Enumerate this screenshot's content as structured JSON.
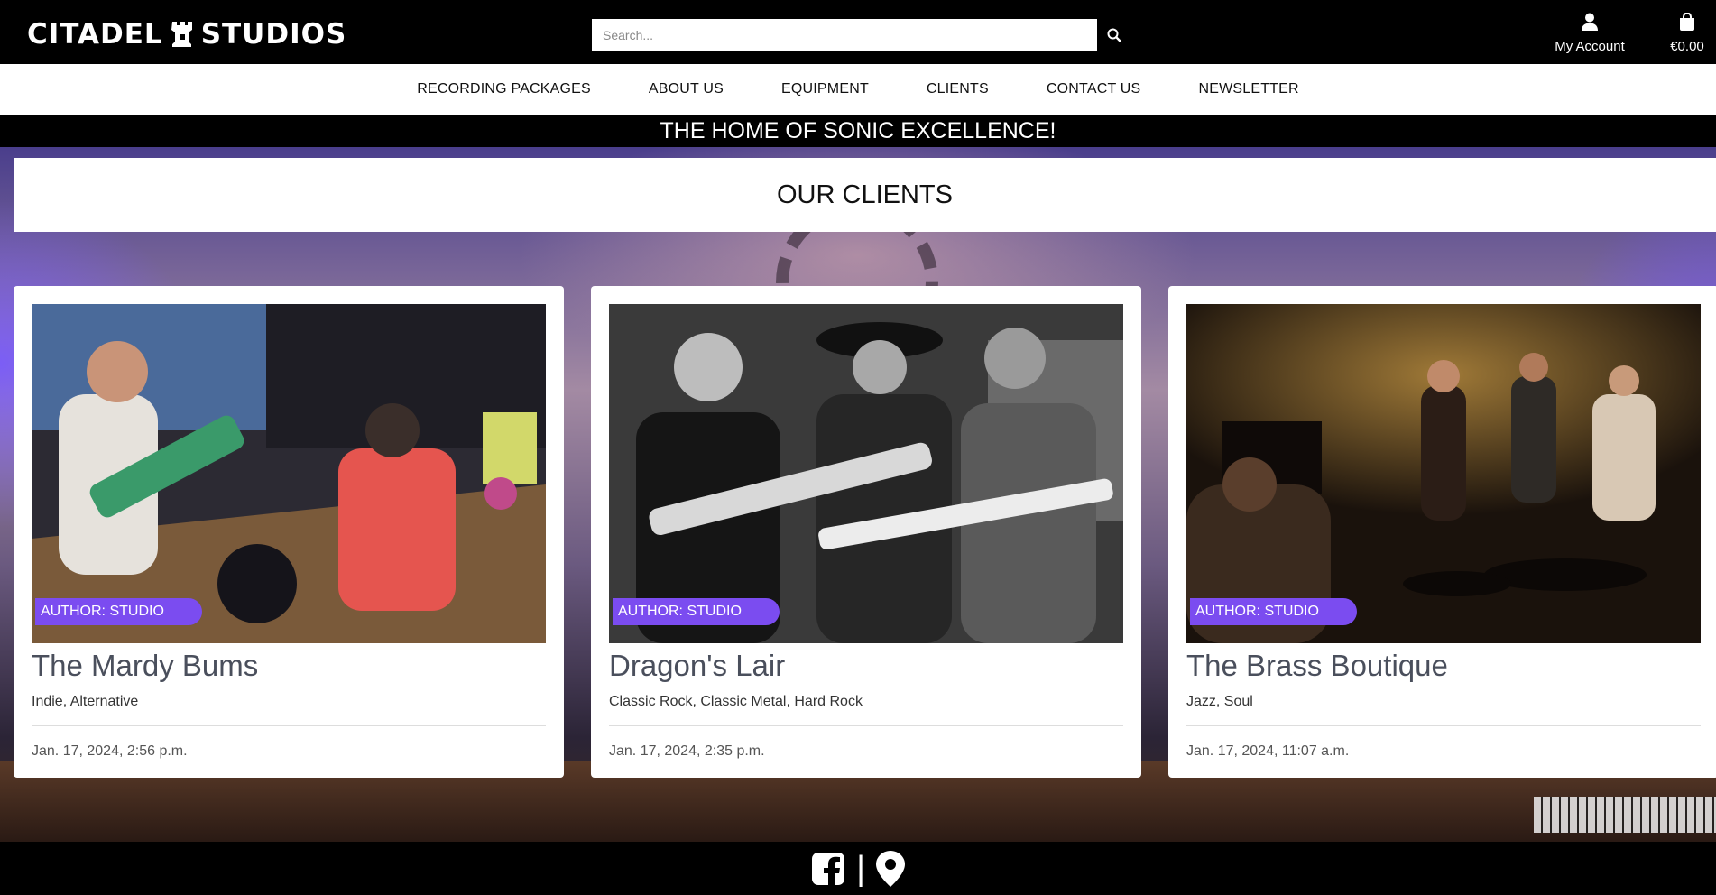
{
  "header": {
    "brand_left": "CITADEL",
    "brand_right": "STUDIOS",
    "search_placeholder": "Search...",
    "account_label": "My Account",
    "cart_total": "€0.00"
  },
  "nav": {
    "items": [
      {
        "label": "RECORDING PACKAGES"
      },
      {
        "label": "ABOUT US"
      },
      {
        "label": "EQUIPMENT"
      },
      {
        "label": "CLIENTS"
      },
      {
        "label": "CONTACT US"
      },
      {
        "label": "NEWSLETTER"
      }
    ]
  },
  "banner": {
    "text": "THE HOME OF SONIC EXCELLENCE!"
  },
  "page": {
    "title": "OUR CLIENTS"
  },
  "clients": [
    {
      "badge": "AUTHOR: STUDIO",
      "name": "The Mardy Bums",
      "genres": "Indie, Alternative",
      "date": "Jan. 17, 2024, 2:56 p.m.",
      "image_subject": "indie-band-live-photo"
    },
    {
      "badge": "AUTHOR: STUDIO",
      "name": "Dragon's Lair",
      "genres": "Classic Rock, Classic Metal, Hard Rock",
      "date": "Jan. 17, 2024, 2:35 p.m.",
      "image_subject": "rock-guitarists-bw-photo"
    },
    {
      "badge": "AUTHOR: STUDIO",
      "name": "The Brass Boutique",
      "genres": "Jazz, Soul",
      "date": "Jan. 17, 2024, 11:07 a.m.",
      "image_subject": "jazz-club-stage-photo"
    }
  ],
  "footer": {
    "icons": [
      "facebook-icon",
      "location-pin-icon"
    ],
    "separator": "|"
  },
  "colors": {
    "badge": "#7b4cf0",
    "title_text": "#4a4f5c",
    "topbar": "#000000"
  }
}
